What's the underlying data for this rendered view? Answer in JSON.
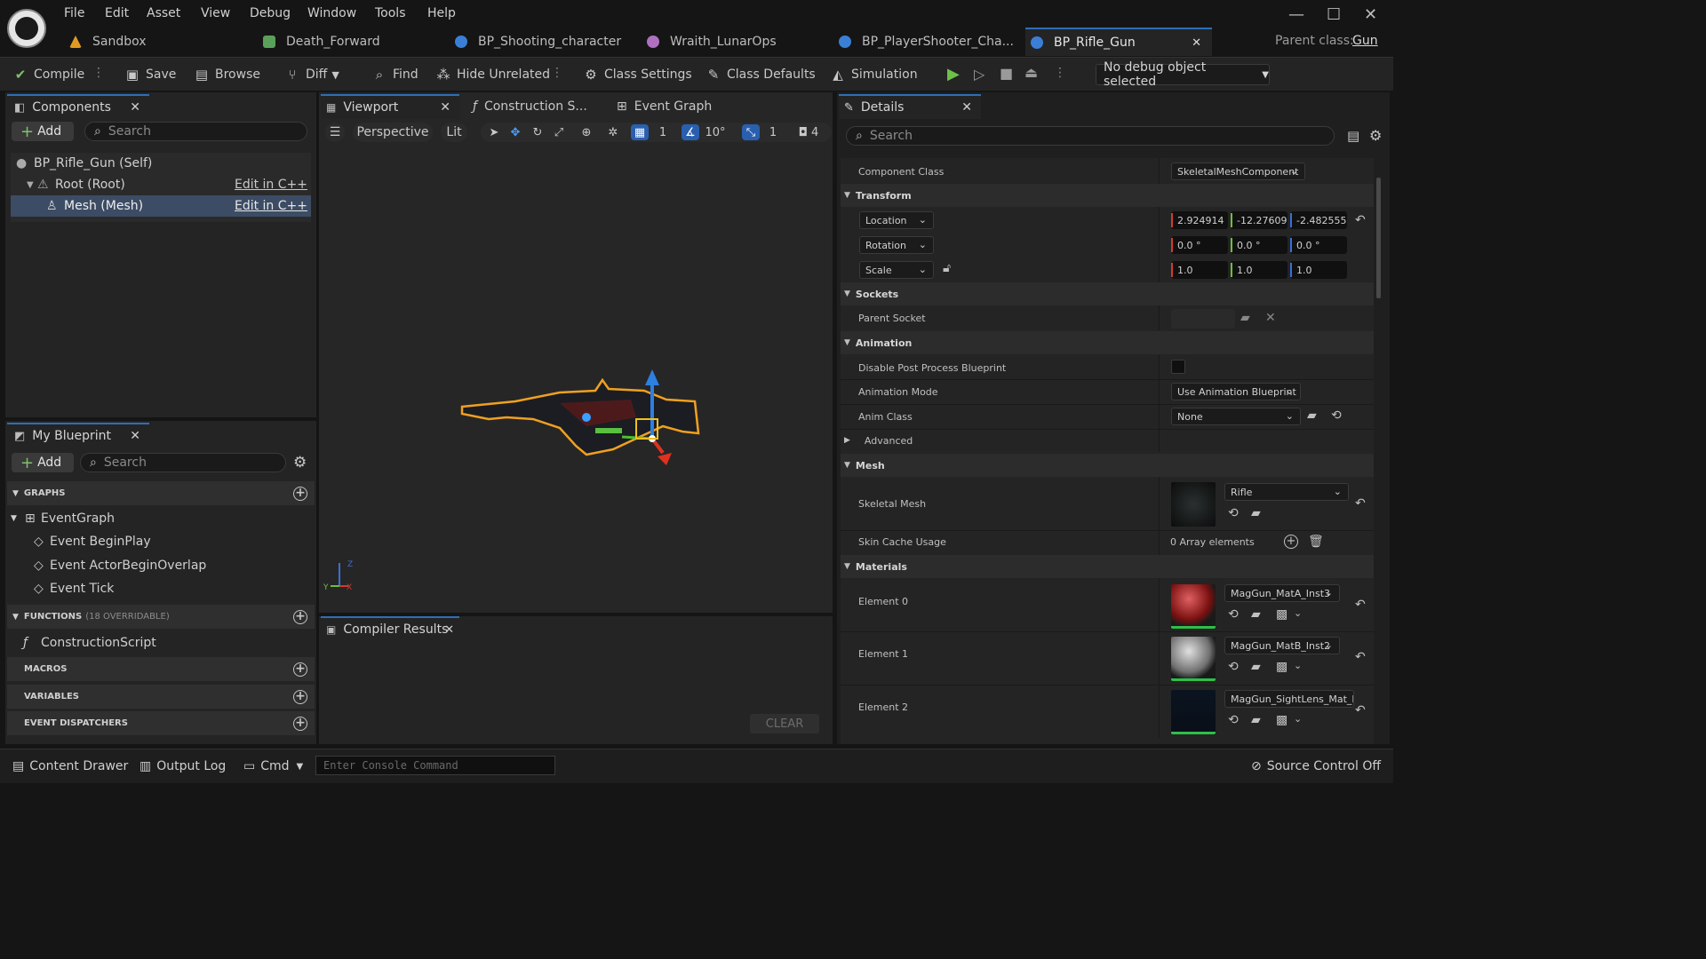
{
  "menu": [
    "File",
    "Edit",
    "Asset",
    "View",
    "Debug",
    "Window",
    "Tools",
    "Help"
  ],
  "tabs": [
    {
      "label": "Sandbox",
      "color": "#e09a22"
    },
    {
      "label": "Death_Forward",
      "color": "#5aa05a"
    },
    {
      "label": "BP_Shooting_character",
      "color": "#3a7fd5"
    },
    {
      "label": "Wraith_LunarOps",
      "color": "#b070c0"
    },
    {
      "label": "BP_PlayerShooter_Cha...",
      "color": "#3a7fd5"
    },
    {
      "label": "BP_Rifle_Gun",
      "color": "#3a7fd5"
    }
  ],
  "parent_class": {
    "label": "Parent class:",
    "value": "Gun"
  },
  "toolbar": {
    "compile": "Compile",
    "save": "Save",
    "browse": "Browse",
    "diff": "Diff",
    "find": "Find",
    "hide_unrelated": "Hide Unrelated",
    "class_settings": "Class Settings",
    "class_defaults": "Class Defaults",
    "simulation": "Simulation",
    "debug_object": "No debug object selected"
  },
  "components": {
    "tab": "Components",
    "add": "Add",
    "search_placeholder": "Search",
    "items": [
      {
        "label": "BP_Rifle_Gun (Self)",
        "edit": ""
      },
      {
        "label": "Root (Root)",
        "edit": "Edit in C++"
      },
      {
        "label": "Mesh (Mesh)",
        "edit": "Edit in C++"
      }
    ]
  },
  "my_blueprint": {
    "tab": "My Blueprint",
    "add": "Add",
    "search_placeholder": "Search",
    "graphs_header": "GRAPHS",
    "event_graph": "EventGraph",
    "events": [
      "Event BeginPlay",
      "Event ActorBeginOverlap",
      "Event Tick"
    ],
    "functions_header": "FUNCTIONS",
    "functions_note": "(18 OVERRIDABLE)",
    "construction_script": "ConstructionScript",
    "macros_header": "MACROS",
    "variables_header": "VARIABLES",
    "dispatchers_header": "EVENT DISPATCHERS"
  },
  "viewport": {
    "tabs": [
      "Viewport",
      "Construction S...",
      "Event Graph"
    ],
    "perspective": "Perspective",
    "lit": "Lit",
    "grid_value": "1",
    "angle_value": "10°",
    "scale_value": "1",
    "camera_value": "4"
  },
  "compiler": {
    "tab": "Compiler Results",
    "clear": "CLEAR"
  },
  "details": {
    "tab": "Details",
    "search_placeholder": "Search",
    "component_class_label": "Component Class",
    "component_class": "SkeletalMeshComponent",
    "transform": "Transform",
    "location_label": "Location",
    "location": [
      "2.924914",
      "-12.27609",
      "-2.482555"
    ],
    "rotation_label": "Rotation",
    "rotation": [
      "0.0 °",
      "0.0 °",
      "0.0 °"
    ],
    "scale_label": "Scale",
    "scale": [
      "1.0",
      "1.0",
      "1.0"
    ],
    "sockets": "Sockets",
    "parent_socket": "Parent Socket",
    "animation": "Animation",
    "disable_pp": "Disable Post Process Blueprint",
    "anim_mode_label": "Animation Mode",
    "anim_mode": "Use Animation Blueprint",
    "anim_class_label": "Anim Class",
    "anim_class": "None",
    "advanced": "Advanced",
    "mesh": "Mesh",
    "skeletal_mesh_label": "Skeletal Mesh",
    "skeletal_mesh": "Rifle",
    "skin_cache_label": "Skin Cache Usage",
    "skin_cache": "0 Array elements",
    "materials": "Materials",
    "elements": [
      {
        "label": "Element 0",
        "value": "MagGun_MatA_Inst3"
      },
      {
        "label": "Element 1",
        "value": "MagGun_MatB_Inst2"
      },
      {
        "label": "Element 2",
        "value": "MagGun_SightLens_Mat_Inst"
      }
    ]
  },
  "status": {
    "content_drawer": "Content Drawer",
    "output_log": "Output Log",
    "cmd": "Cmd",
    "console_placeholder": "Enter Console Command",
    "source_control": "Source Control Off"
  }
}
